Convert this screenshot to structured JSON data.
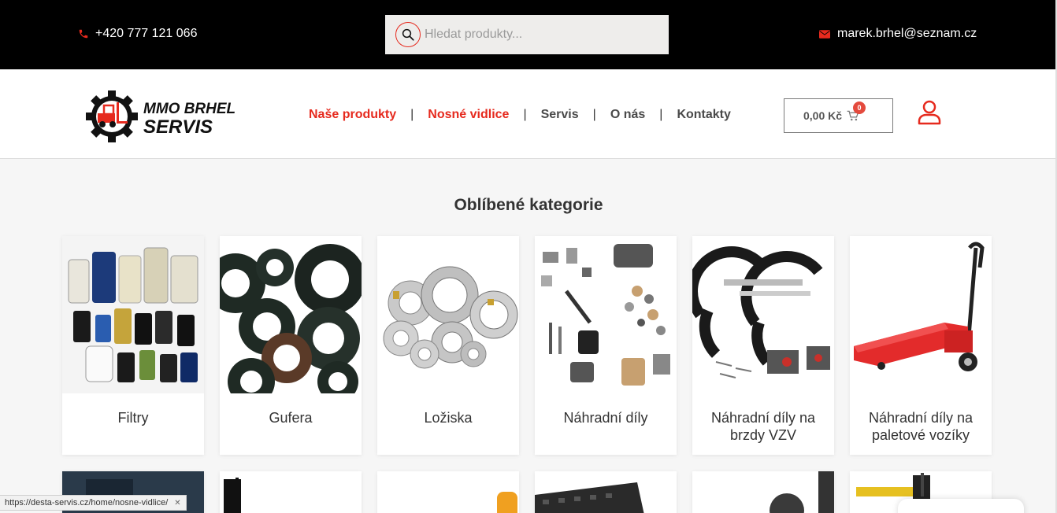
{
  "topbar": {
    "phone": "+420 777 121 066",
    "search_placeholder": "Hledat produkty...",
    "email": "marek.brhel@seznam.cz"
  },
  "logo": {
    "line1": "MMO BRHEL",
    "line2": "SERVIS"
  },
  "nav": {
    "items": [
      {
        "label": "Naše produkty",
        "active": true
      },
      {
        "label": "Nosné vidlice",
        "active": true
      },
      {
        "label": "Servis",
        "active": false
      },
      {
        "label": "O nás",
        "active": false
      },
      {
        "label": "Kontakty",
        "active": false
      }
    ],
    "separator": "|"
  },
  "cart": {
    "total": "0,00 Kč",
    "count": "0"
  },
  "main": {
    "title": "Oblíbené kategorie",
    "categories": [
      {
        "label": "Filtry"
      },
      {
        "label": "Gufera"
      },
      {
        "label": "Ložiska"
      },
      {
        "label": "Náhradní díly"
      },
      {
        "label": "Náhradní díly na brzdy VZV"
      },
      {
        "label": "Náhradní díly na paletové vozíky"
      }
    ]
  },
  "statusbar": {
    "url": "https://desta-servis.cz/home/nosne-vidlice/"
  },
  "colors": {
    "accent": "#e62a1e",
    "topbar": "#000000",
    "background": "#f6f6f6"
  }
}
